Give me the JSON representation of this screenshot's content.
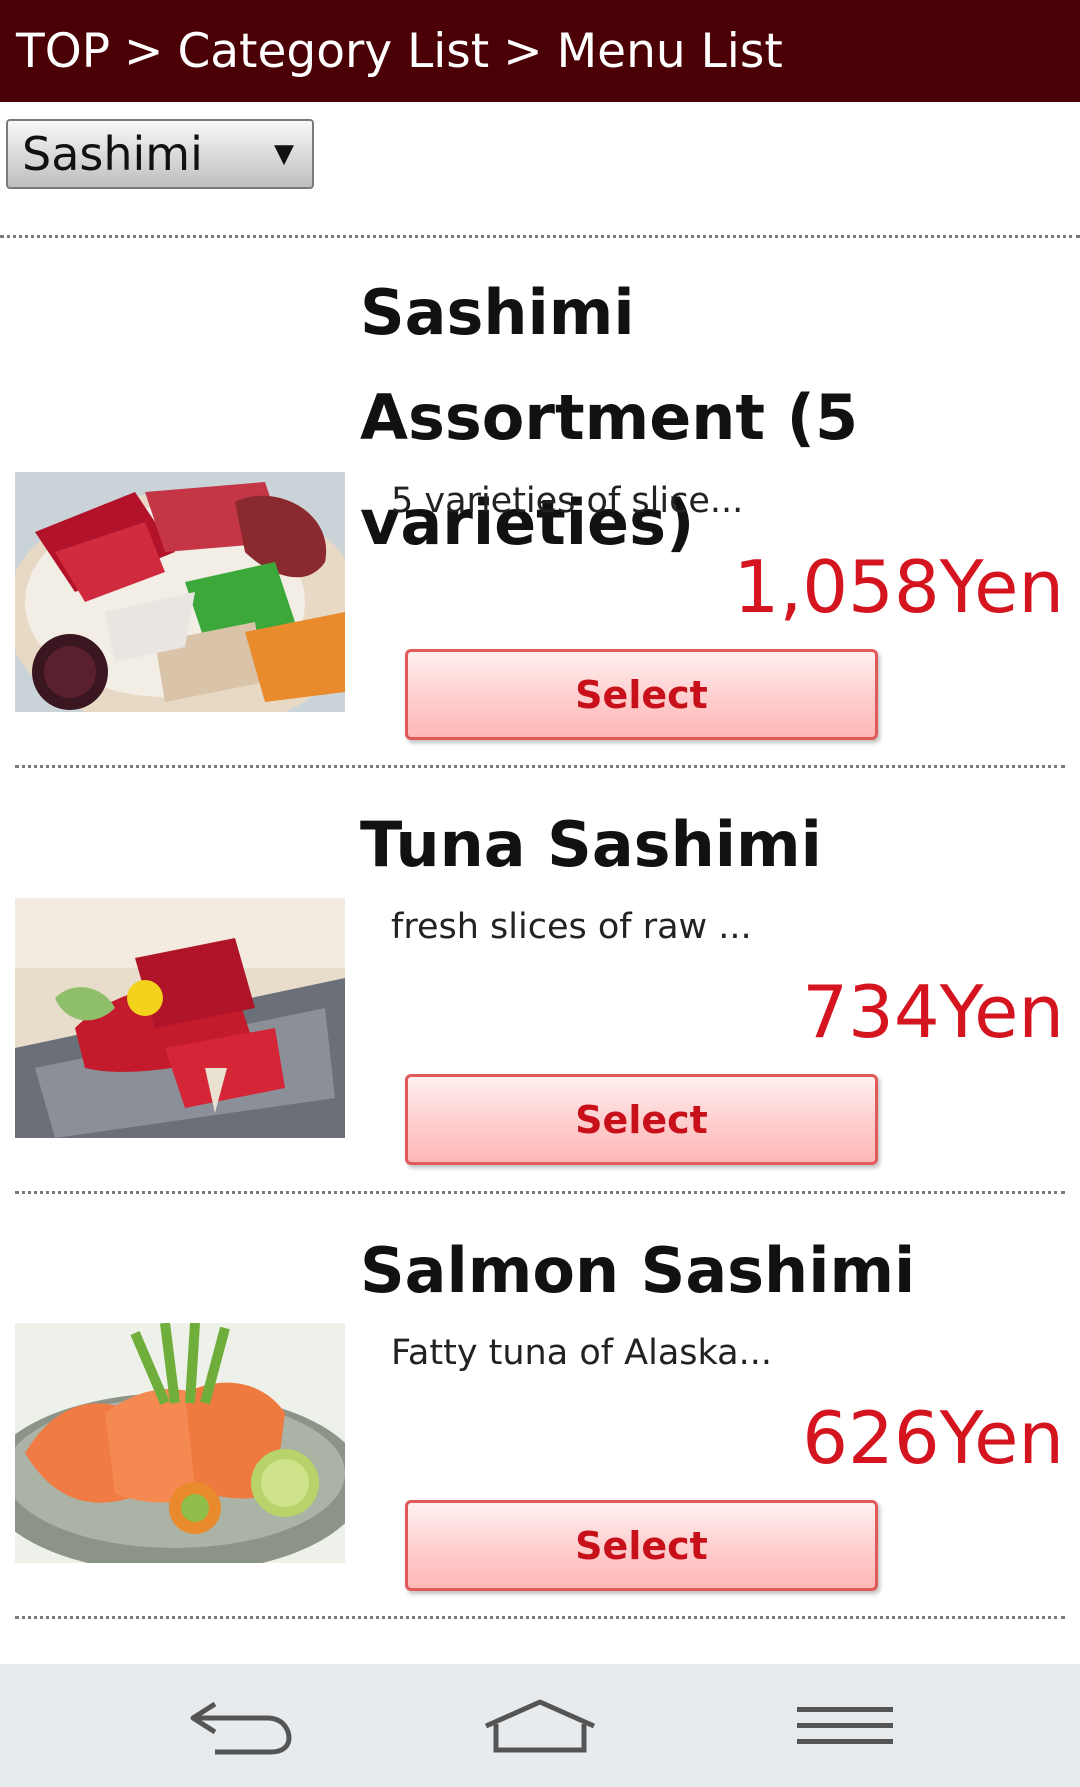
{
  "breadcrumb": {
    "top": "TOP",
    "separator": ">",
    "category_list": "Category List",
    "menu_list": "Menu List"
  },
  "category_select": {
    "selected": "Sashimi",
    "arrow_icon": "triangle-down-icon"
  },
  "items": [
    {
      "name": "Sashimi Assortment (5 varieties)",
      "description": "5 varieties of slice...",
      "price": "1,058Yen",
      "select_label": "Select",
      "image": "sashimi-assortment-photo"
    },
    {
      "name": "Tuna Sashimi",
      "description": "fresh slices of raw ...",
      "price": "734Yen",
      "select_label": "Select",
      "image": "tuna-sashimi-photo"
    },
    {
      "name": "Salmon Sashimi",
      "description": "Fatty tuna of Alaska...",
      "price": "626Yen",
      "select_label": "Select",
      "image": "salmon-sashimi-photo"
    }
  ],
  "navbar": {
    "back_icon": "back-arrow-icon",
    "home_icon": "home-icon",
    "menu_icon": "menu-icon"
  },
  "colors": {
    "header_bg": "#4a0004",
    "price": "#d4141f",
    "button_text": "#c8101a",
    "navbar_bg": "#e8ebee"
  }
}
